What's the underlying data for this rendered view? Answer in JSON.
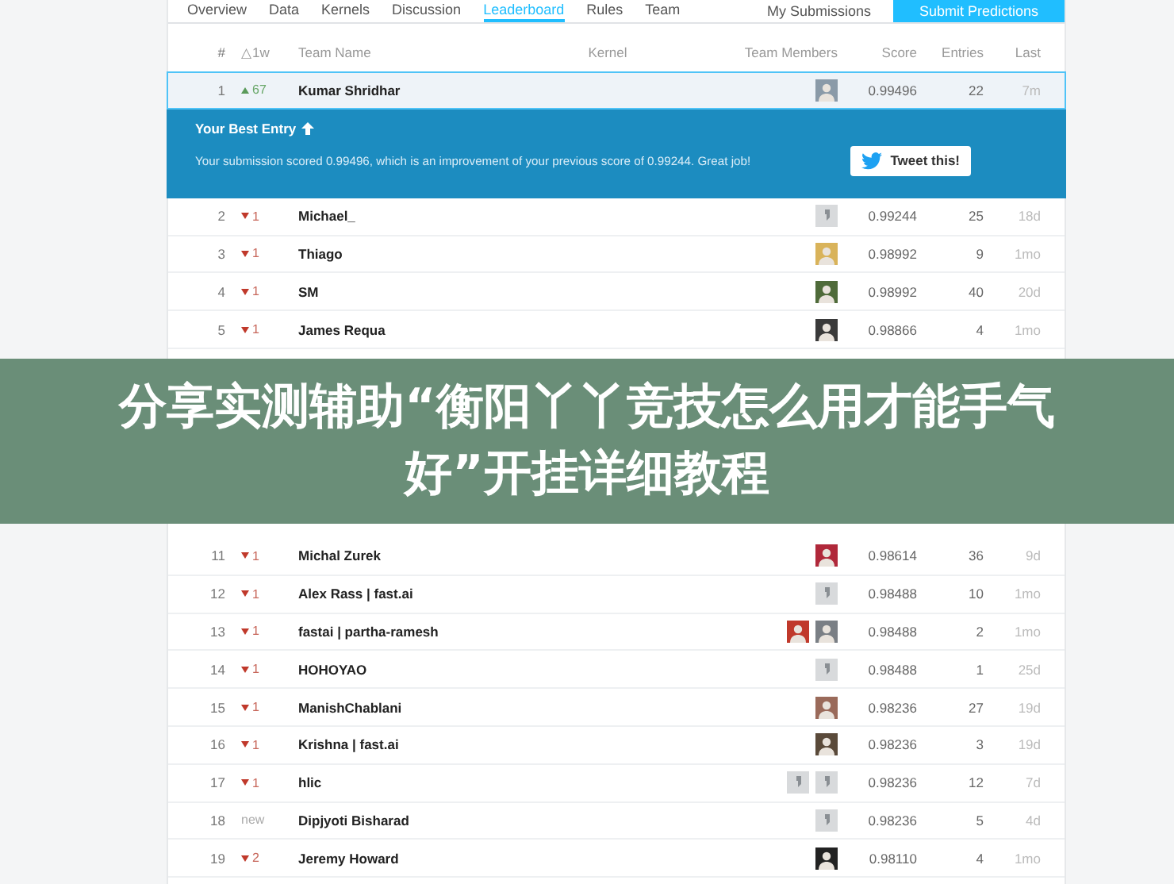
{
  "nav": {
    "tabs": [
      {
        "label": "Overview",
        "selected": false
      },
      {
        "label": "Data",
        "selected": false
      },
      {
        "label": "Kernels",
        "selected": false
      },
      {
        "label": "Discussion",
        "selected": false
      },
      {
        "label": "Leaderboard",
        "selected": true
      },
      {
        "label": "Rules",
        "selected": false
      },
      {
        "label": "Team",
        "selected": false
      }
    ],
    "link": "My Submissions",
    "button": "Submit Predictions"
  },
  "columns": [
    "#",
    "△1w",
    "Team Name",
    "Kernel",
    "Team Members",
    "Score",
    "Entries",
    "Last"
  ],
  "best_entry": {
    "title": "Your Best Entry",
    "message": "Your submission scored 0.99496, which is an improvement of your previous score of 0.99244. Great job!",
    "button": "Tweet this!"
  },
  "rows": [
    {
      "rank": "1",
      "change": {
        "kind": "up",
        "text": "67"
      },
      "name": "Kumar Shridhar",
      "members": [
        {
          "kind": "photo",
          "color": "#8a9aa8"
        }
      ],
      "score": "0.99496",
      "entries": "22",
      "last": "7m",
      "selected": true
    },
    {
      "rank": "2",
      "change": {
        "kind": "down",
        "text": "1"
      },
      "name": "Michael_",
      "members": [
        {
          "kind": "default"
        }
      ],
      "score": "0.99244",
      "entries": "25",
      "last": "18d",
      "selected": false
    },
    {
      "rank": "3",
      "change": {
        "kind": "down",
        "text": "1"
      },
      "name": "Thiago",
      "members": [
        {
          "kind": "photo",
          "color": "#d9b35a"
        }
      ],
      "score": "0.98992",
      "entries": "9",
      "last": "1mo",
      "selected": false
    },
    {
      "rank": "4",
      "change": {
        "kind": "down",
        "text": "1"
      },
      "name": "SM",
      "members": [
        {
          "kind": "photo",
          "color": "#4f6b3a"
        }
      ],
      "score": "0.98992",
      "entries": "40",
      "last": "20d",
      "selected": false
    },
    {
      "rank": "5",
      "change": {
        "kind": "down",
        "text": "1"
      },
      "name": "James Requa",
      "members": [
        {
          "kind": "photo",
          "color": "#3a3a3a"
        }
      ],
      "score": "0.98866",
      "entries": "4",
      "last": "1mo",
      "selected": false
    },
    {
      "kind": "hidden"
    },
    {
      "rank": "11",
      "change": {
        "kind": "down",
        "text": "1"
      },
      "name": "Michal Zurek",
      "members": [
        {
          "kind": "photo",
          "color": "#b0283a"
        }
      ],
      "score": "0.98614",
      "entries": "36",
      "last": "9d",
      "selected": false
    },
    {
      "rank": "12",
      "change": {
        "kind": "down",
        "text": "1"
      },
      "name": "Alex Rass | fast.ai",
      "members": [
        {
          "kind": "default"
        }
      ],
      "score": "0.98488",
      "entries": "10",
      "last": "1mo",
      "selected": false
    },
    {
      "rank": "13",
      "change": {
        "kind": "down",
        "text": "1"
      },
      "name": "fastai | partha-ramesh",
      "members": [
        {
          "kind": "photo",
          "color": "#c0392b"
        },
        {
          "kind": "photo",
          "color": "#7a7f85"
        }
      ],
      "score": "0.98488",
      "entries": "2",
      "last": "1mo",
      "selected": false
    },
    {
      "rank": "14",
      "change": {
        "kind": "down",
        "text": "1"
      },
      "name": "HOHOYAO",
      "members": [
        {
          "kind": "default"
        }
      ],
      "score": "0.98488",
      "entries": "1",
      "last": "25d",
      "selected": false
    },
    {
      "rank": "15",
      "change": {
        "kind": "down",
        "text": "1"
      },
      "name": "ManishChablani",
      "members": [
        {
          "kind": "photo",
          "color": "#9a6a5a"
        }
      ],
      "score": "0.98236",
      "entries": "27",
      "last": "19d",
      "selected": false
    },
    {
      "rank": "16",
      "change": {
        "kind": "down",
        "text": "1"
      },
      "name": "Krishna | fast.ai",
      "members": [
        {
          "kind": "photo",
          "color": "#5a4a3a"
        }
      ],
      "score": "0.98236",
      "entries": "3",
      "last": "19d",
      "selected": false
    },
    {
      "rank": "17",
      "change": {
        "kind": "down",
        "text": "1"
      },
      "name": "hlic",
      "members": [
        {
          "kind": "default"
        },
        {
          "kind": "default"
        }
      ],
      "score": "0.98236",
      "entries": "12",
      "last": "7d",
      "selected": false
    },
    {
      "rank": "18",
      "change": {
        "kind": "new",
        "text": "new"
      },
      "name": "Dipjyoti Bisharad",
      "members": [
        {
          "kind": "default"
        }
      ],
      "score": "0.98236",
      "entries": "5",
      "last": "4d",
      "selected": false
    },
    {
      "rank": "19",
      "change": {
        "kind": "down",
        "text": "2"
      },
      "name": "Jeremy Howard",
      "members": [
        {
          "kind": "photo",
          "color": "#222222"
        }
      ],
      "score": "0.98110",
      "entries": "4",
      "last": "1mo",
      "selected": false
    }
  ],
  "banner": {
    "text": "分享实测辅助“衡阳丫丫竞技怎么用才能手气好”开挂详细教程"
  }
}
